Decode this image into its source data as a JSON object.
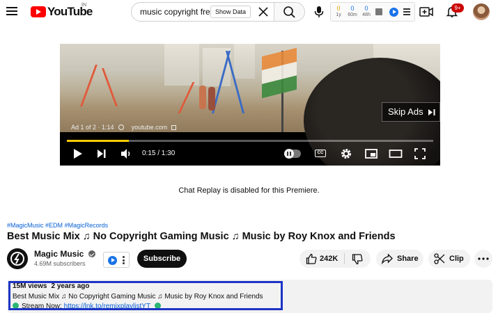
{
  "header": {
    "logo_text": "YouTube",
    "logo_region": "IN",
    "search": {
      "value": "music copyright free",
      "placeholder": "Search",
      "show_data_label": "Show Data"
    },
    "extension_stats": [
      {
        "value": "0",
        "label": "1y",
        "color": "#e8a400"
      },
      {
        "value": "0",
        "label": "60m",
        "color": "#1a73e8"
      },
      {
        "value": "0",
        "label": "48h",
        "color": "#1a73e8"
      }
    ],
    "notification_count": "9+"
  },
  "player": {
    "skip_ads_label": "Skip Ads",
    "ad_counter": "Ad 1 of 2 · 1:14",
    "ad_domain": "youtube.com",
    "time": "0:15 / 1:30",
    "progress": 0.17,
    "progress_color": "#ffcc00"
  },
  "chat_replay_text": "Chat Replay is disabled for this Premiere.",
  "video": {
    "hashtags": [
      "#MagicMusic",
      "#EDM",
      "#MagicRecords"
    ],
    "title": "Best Music Mix ♫ No Copyright Gaming Music ♫ Music by Roy Knox and Friends",
    "channel_name": "Magic Music",
    "subscribers": "4.69M subscribers",
    "subscribe_label": "Subscribe",
    "likes": "242K",
    "share_label": "Share",
    "clip_label": "Clip"
  },
  "description": {
    "views": "15M views",
    "age": "2 years ago",
    "line1": "Best Music Mix ♫ No Copyright Gaming Music ♫ Music by Roy Knox and Friends",
    "stream_label": "Stream Now:",
    "stream_link": "https://lnk.to/remixplaylistYT"
  }
}
